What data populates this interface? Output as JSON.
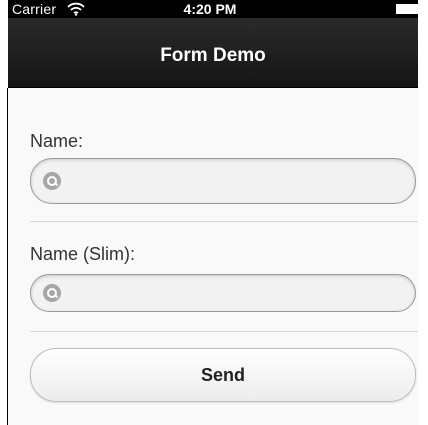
{
  "status_bar": {
    "carrier": "Carrier",
    "time": "4:20 PM",
    "wifi_icon": "wifi-icon",
    "battery_icon": "battery-icon"
  },
  "nav_bar": {
    "title": "Form Demo"
  },
  "form": {
    "name_label": "Name:",
    "name_value": "",
    "name_slim_label": "Name (Slim):",
    "name_slim_value": "",
    "search_icon": "search-icon",
    "send_label": "Send"
  },
  "colors": {
    "status_bar_bg": "#000000",
    "nav_bar_bg": "#1f1f1f",
    "page_bg": "#f9f9f9",
    "input_border": "#9a9a9a",
    "button_bg": "#ffffff"
  }
}
